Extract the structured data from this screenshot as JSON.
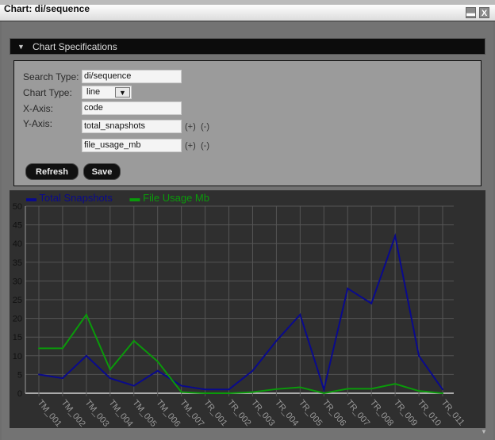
{
  "window": {
    "title": "Chart: di/sequence",
    "minimize_label": "▬",
    "close_label": "X"
  },
  "spec": {
    "header": "Chart Specifications",
    "search_type_label": "Search Type:",
    "search_type_value": "di/sequence",
    "chart_type_label": "Chart Type:",
    "chart_type_value": "line",
    "x_axis_label": "X-Axis:",
    "x_axis_value": "code",
    "y_axis_label": "Y-Axis:",
    "y_axes": [
      {
        "value": "total_snapshots",
        "add": "(+)",
        "remove": "(-)"
      },
      {
        "value": "file_usage_mb",
        "add": "(+)",
        "remove": "(-)"
      }
    ],
    "refresh_label": "Refresh",
    "save_label": "Save"
  },
  "chart_data": {
    "type": "line",
    "grid": true,
    "legend": "top-left",
    "ylim": [
      0,
      50
    ],
    "yticks": [
      0,
      5,
      10,
      15,
      20,
      25,
      30,
      35,
      40,
      45,
      50
    ],
    "categories": [
      "TM_001",
      "TM_002",
      "TM_003",
      "TM_004",
      "TM_005",
      "TM_006",
      "TM_007",
      "TR_001",
      "TR_002",
      "TR_003",
      "TR_004",
      "TR_005",
      "TR_006",
      "TR_007",
      "TR_008",
      "TR_009",
      "TR_010",
      "TR_011"
    ],
    "series": [
      {
        "name": "Total Snapshots",
        "color": "#0a0a8c",
        "values": [
          5,
          4,
          10,
          4,
          2,
          6,
          2,
          1,
          1,
          6,
          14,
          21,
          1,
          28,
          24,
          42,
          10,
          1
        ]
      },
      {
        "name": "File Usage Mb",
        "color": "#0a9a0a",
        "values": [
          12,
          12,
          21,
          6.3,
          14,
          8.5,
          0.3,
          0,
          0,
          0.3,
          1.1,
          1.6,
          0,
          1.2,
          1.2,
          2.5,
          0.6,
          0
        ]
      }
    ]
  }
}
